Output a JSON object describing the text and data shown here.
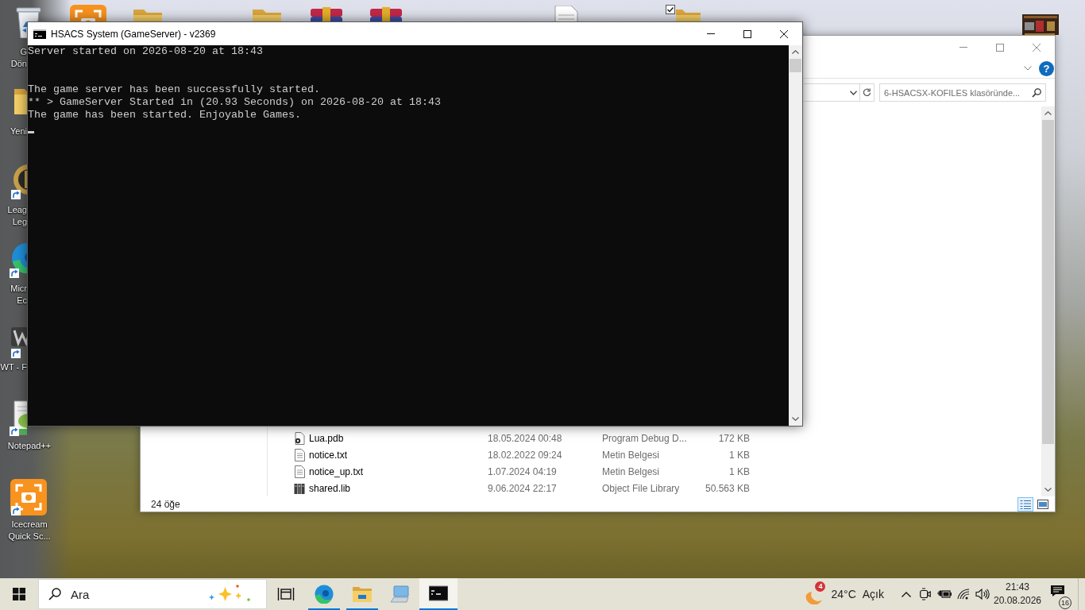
{
  "desktop_icons": [
    {
      "kind": "recycle",
      "label_lines": [
        "G",
        "Dön"
      ],
      "shortcut": false,
      "selected": false
    },
    {
      "kind": "screenshot",
      "selected": false
    },
    {
      "kind": "folder",
      "selected": false
    },
    {
      "kind": "folder",
      "selected": false
    },
    {
      "kind": "archive",
      "selected": false
    },
    {
      "kind": "archive",
      "selected": false
    },
    {
      "kind": "document",
      "selected": false
    },
    {
      "kind": "folder",
      "selected": true
    },
    {
      "kind": "image",
      "selected": false
    },
    {
      "kind": "folder",
      "label_lines": [
        "Yeni"
      ],
      "shortcut": false,
      "selected": false
    },
    {
      "kind": "game",
      "label_lines": [
        "Leag",
        "Leg"
      ],
      "shortcut": true,
      "selected": false
    },
    {
      "kind": "browser",
      "label_lines": [
        "Micr",
        "Ec"
      ],
      "shortcut": true,
      "selected": false
    },
    {
      "kind": "logo",
      "label_lines": [
        "WT - F"
      ],
      "shortcut": true,
      "selected": false
    },
    {
      "kind": "editor",
      "label_lines": [
        "Notepad++"
      ],
      "shortcut": true,
      "selected": false
    },
    {
      "kind": "screenshot",
      "label_lines": [
        "Icecream",
        "Quick Sc..."
      ],
      "shortcut": true,
      "selected": false
    }
  ],
  "explorer_window": {
    "active": false,
    "help_button": "?",
    "search": {
      "placeholder": "6-HSACSX-KOFILES klasöründe..."
    },
    "files": [
      {
        "kind": "pdb",
        "name": "Lua.pdb",
        "modified": "18.05.2024 00:48",
        "type": "Program Debug D...",
        "size": "172 KB",
        "selected": false
      },
      {
        "kind": "text",
        "name": "notice.txt",
        "modified": "18.02.2022 09:24",
        "type": "Metin Belgesi",
        "size": "1 KB",
        "selected": false
      },
      {
        "kind": "text",
        "name": "notice_up.txt",
        "modified": "1.07.2024 04:19",
        "type": "Metin Belgesi",
        "size": "1 KB",
        "selected": false
      },
      {
        "kind": "library",
        "name": "shared.lib",
        "modified": "9.06.2024 22:17",
        "type": "Object File Library",
        "size": "50.563 KB",
        "selected": false
      }
    ],
    "status": "24 öğe",
    "view_buttons": [
      {
        "kind": "details",
        "selected": true
      },
      {
        "kind": "tiles",
        "selected": false
      }
    ]
  },
  "console_window": {
    "title": "HSACS System (GameServer) - v2369",
    "active": true,
    "output": [
      [
        "Server started on 2026-08-20 at 18:43"
      ],
      [
        "The game server has been successfully started.",
        "** > GameServer Started in (20.93 Seconds) on 2026-08-20 at 18:43",
        "The game has been started. Enjoyable Games."
      ]
    ]
  },
  "taskbar": {
    "search": {
      "placeholder": "Ara"
    },
    "apps": [
      {
        "kind": "browser",
        "running": true,
        "selected": false
      },
      {
        "kind": "files",
        "running": true,
        "selected": false
      },
      {
        "kind": "computer",
        "running": false,
        "selected": false
      },
      {
        "kind": "terminal",
        "running": true,
        "selected": true
      }
    ],
    "weather": {
      "alert_count": "4",
      "temperature": "24°C",
      "condition": "Açık"
    },
    "clock": {
      "time": "21:43",
      "date": "20.08.2026"
    },
    "notifications": {
      "count": "16"
    }
  }
}
